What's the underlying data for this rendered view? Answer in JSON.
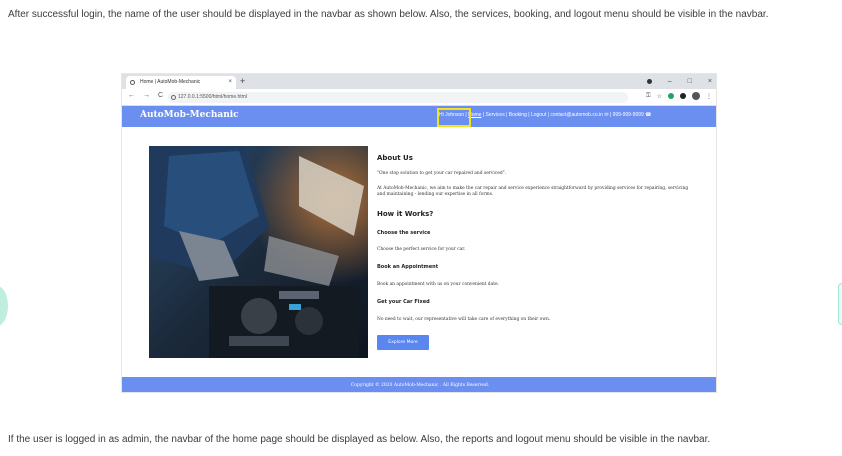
{
  "doc": {
    "intro": "After successful login, the name of the user should be displayed in the navbar as shown below. Also, the services, booking, and logout menu should be visible in the navbar.",
    "outro": "If the user is logged in as admin, the navbar of the home page should be displayed as below. Also, the reports and logout menu should be visible in the navbar."
  },
  "browser": {
    "tab_title": "Home | AutoMob-Mechanic",
    "tab_close": "×",
    "new_tab": "+",
    "url": "127.0.0.1:5500/html/home.html",
    "win_min": "–",
    "win_max": "□",
    "win_close": "×",
    "nav_back": "←",
    "nav_forward": "→",
    "nav_reload": "C"
  },
  "site": {
    "brand": "AutoMob-Mechanic",
    "nav": {
      "hi_user": "Hi Johnson",
      "home": "Home",
      "services": "Services",
      "booking": "Booking",
      "logout": "Logout",
      "email": "contact@automob.co.in",
      "phone": "999-999-9999",
      "sep": " | "
    },
    "about_title": "About Us",
    "about_quote": "\"One stop solution to get your car repaired and serviced\".",
    "about_text": "At AutoMob-Mechanic, we aim to make the car repair and service experience straightforward by providing services for repairing, servicing and maintaining - lending our expertise in all forms.",
    "how_title": "How it Works?",
    "step1_title": "Choose the service",
    "step1_text": "Choose the perfect service for your car.",
    "step2_title": "Book an Appointment",
    "step2_text": "Book an appointment with us on your convenient date.",
    "step3_title": "Get your Car Fixed",
    "step3_text": "No need to wait, our representative will take care of everything on their own.",
    "explore": "Explore More",
    "footer": "Copyright © 2020 AutoMob-Mechanic . All Rights Reserved."
  },
  "colors": {
    "navbar": "#6b8ff0",
    "highlight_box": "#f3e21c",
    "button": "#5a86f0"
  }
}
